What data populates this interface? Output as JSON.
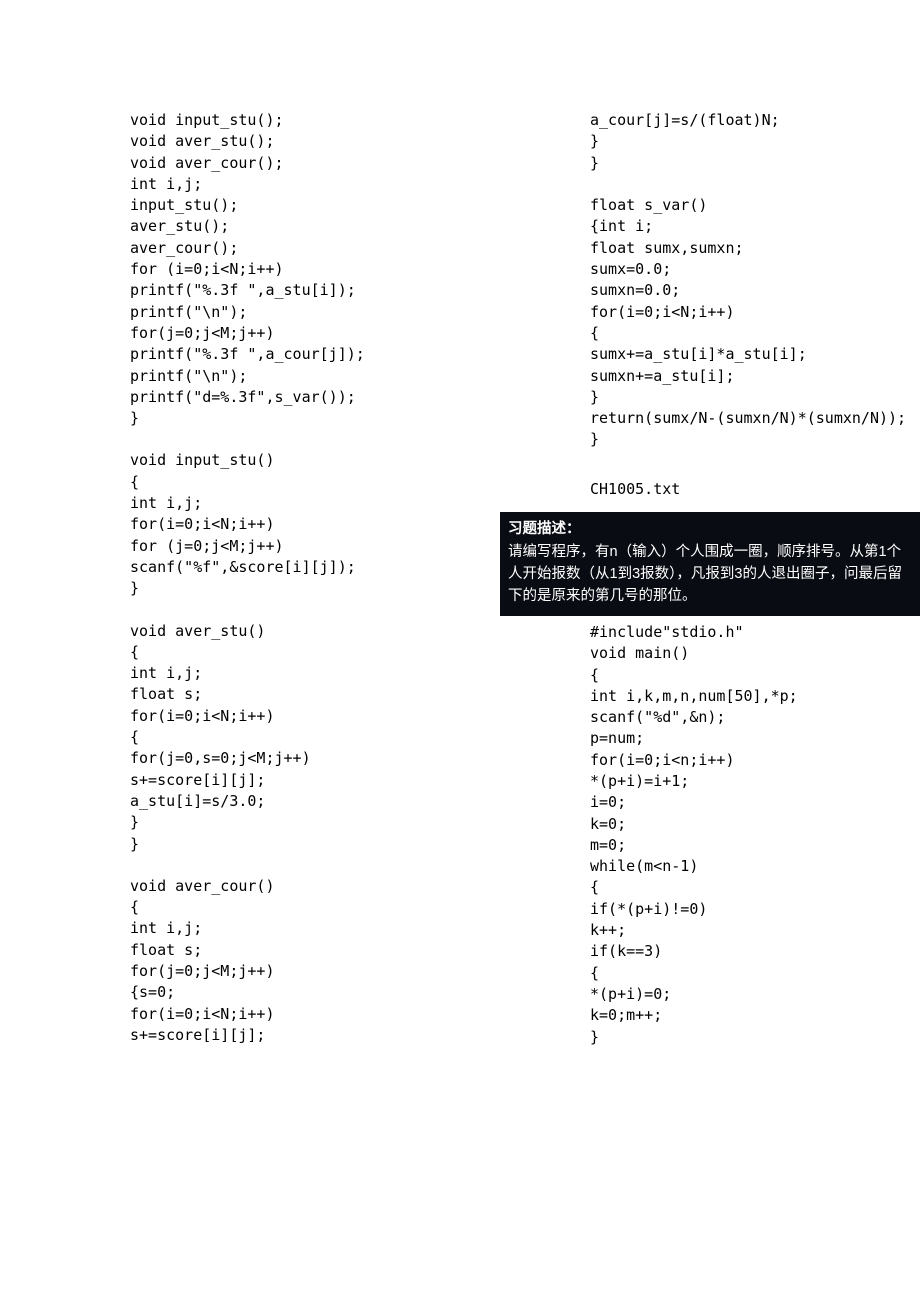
{
  "left": {
    "block1": "void input_stu();\nvoid aver_stu();\nvoid aver_cour();\nint i,j;\ninput_stu();\naver_stu();\naver_cour();\nfor (i=0;i<N;i++)\nprintf(\"%.3f \",a_stu[i]);\nprintf(\"\\n\");\nfor(j=0;j<M;j++)\nprintf(\"%.3f \",a_cour[j]);\nprintf(\"\\n\");\nprintf(\"d=%.3f\",s_var());\n}",
    "block2": "void input_stu()\n{\nint i,j;\nfor(i=0;i<N;i++)\nfor (j=0;j<M;j++)\nscanf(\"%f\",&score[i][j]);\n}",
    "block3": "void aver_stu()\n{\nint i,j;\nfloat s;\nfor(i=0;i<N;i++)\n{\nfor(j=0,s=0;j<M;j++)\ns+=score[i][j];\na_stu[i]=s/3.0;\n}\n}",
    "block4": "void aver_cour()\n{\nint i,j;\nfloat s;\nfor(j=0;j<M;j++)\n{s=0;\nfor(i=0;i<N;i++)\ns+=score[i][j];"
  },
  "right": {
    "upper": "a_cour[j]=s/(float)N;\n}\n}\n\nfloat s_var()\n{int i;\nfloat sumx,sumxn;\nsumx=0.0;\nsumxn=0.0;\nfor(i=0;i<N;i++)\n{\nsumx+=a_stu[i]*a_stu[i];\nsumxn+=a_stu[i];\n}\nreturn(sumx/N-(sumxn/N)*(sumxn/N));\n}",
    "filename": "CH1005.txt",
    "problem_title": "习题描述：",
    "problem_body": "请编写程序，有n（输入）个人围成一圈，顺序排号。从第1个人开始报数（从1到3报数），凡报到3的人退出圈子，问最后留下的是原来的第几号的那位。",
    "lower": "#include\"stdio.h\"\nvoid main()\n{\nint i,k,m,n,num[50],*p;\nscanf(\"%d\",&n);\np=num;\nfor(i=0;i<n;i++)\n*(p+i)=i+1;\ni=0;\nk=0;\nm=0;\nwhile(m<n-1)\n{\nif(*(p+i)!=0)\nk++;\nif(k==3)\n{\n*(p+i)=0;\nk=0;m++;\n}"
  }
}
